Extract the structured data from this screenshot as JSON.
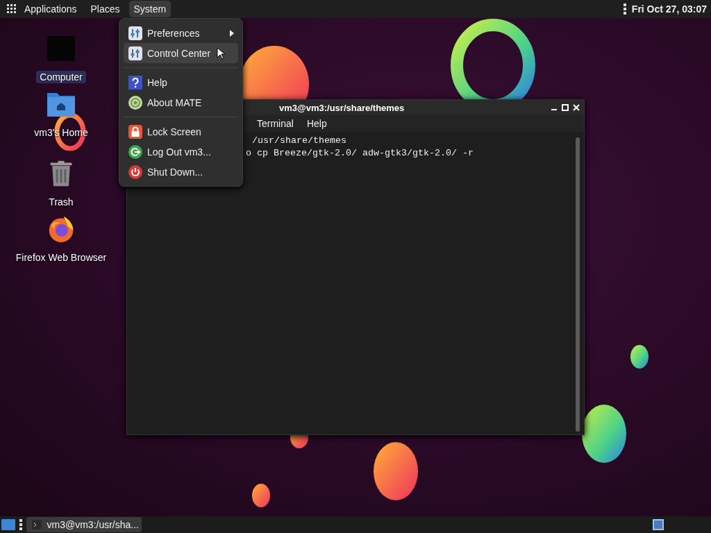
{
  "top_panel": {
    "menus": [
      {
        "label": "Applications",
        "selected": false
      },
      {
        "label": "Places",
        "selected": false
      },
      {
        "label": "System",
        "selected": true
      }
    ],
    "clock": "Fri Oct 27, 03:07"
  },
  "desktop": {
    "icons": [
      {
        "label": "Computer",
        "kind": "computer",
        "selected": true
      },
      {
        "label": "vm3's Home",
        "kind": "home",
        "selected": false
      },
      {
        "label": "Trash",
        "kind": "trash",
        "selected": false
      },
      {
        "label": "Firefox Web Browser",
        "kind": "firefox",
        "selected": false
      }
    ]
  },
  "terminal": {
    "title": "vm3@vm3:/usr/share/themes",
    "menu": [
      "Terminal",
      "Help"
    ],
    "lines": [
      "/usr/share/themes",
      "o cp Breeze/gtk-2.0/ adw-gtk3/gtk-2.0/ -r"
    ]
  },
  "system_menu": {
    "groups": [
      [
        {
          "label": "Preferences",
          "kind": "preferences",
          "submenu": true,
          "selected": false
        },
        {
          "label": "Control Center",
          "kind": "control-center",
          "submenu": false,
          "selected": true
        }
      ],
      [
        {
          "label": "Help",
          "kind": "help",
          "submenu": false,
          "selected": false
        },
        {
          "label": "About MATE",
          "kind": "about",
          "submenu": false,
          "selected": false
        }
      ],
      [
        {
          "label": "Lock Screen",
          "kind": "lock",
          "submenu": false,
          "selected": false
        },
        {
          "label": "Log Out vm3...",
          "kind": "logout",
          "submenu": false,
          "selected": false
        },
        {
          "label": "Shut Down...",
          "kind": "shutdown",
          "submenu": false,
          "selected": false
        }
      ]
    ]
  },
  "taskbar": {
    "tasks": [
      {
        "label": "vm3@vm3:/usr/sha..."
      }
    ]
  }
}
